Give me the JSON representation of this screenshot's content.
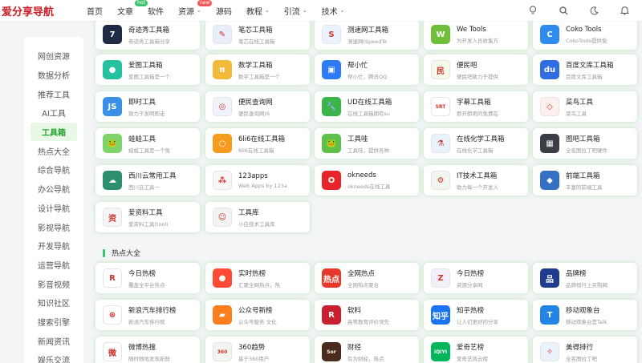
{
  "header": {
    "logo": "爱分享导航",
    "nav": [
      {
        "label": "首页",
        "chev": false
      },
      {
        "label": "文章",
        "chev": false,
        "badge": "hot",
        "badge_color": "green"
      },
      {
        "label": "软件",
        "chev": false
      },
      {
        "label": "资源",
        "chev": true,
        "badge": "new",
        "badge_color": "red"
      },
      {
        "label": "源码",
        "chev": false
      },
      {
        "label": "教程",
        "chev": true
      },
      {
        "label": "引流",
        "chev": true
      },
      {
        "label": "技术",
        "chev": true
      }
    ],
    "icons": [
      "bulb-icon",
      "search-icon",
      "moon-icon",
      "bell-icon"
    ]
  },
  "sidebar": {
    "items": [
      {
        "label": "网创资源",
        "active": false
      },
      {
        "label": "数据分析",
        "active": false
      },
      {
        "label": "推荐工具",
        "active": false
      },
      {
        "label": "AI工具",
        "active": false
      },
      {
        "label": "工具箱",
        "active": true
      },
      {
        "label": "热点大全",
        "active": false
      },
      {
        "label": "综合导航",
        "active": false
      },
      {
        "label": "办公导航",
        "active": false
      },
      {
        "label": "设计导航",
        "active": false
      },
      {
        "label": "影视导航",
        "active": false
      },
      {
        "label": "开发导航",
        "active": false
      },
      {
        "label": "运营导航",
        "active": false
      },
      {
        "label": "影音视频",
        "active": false
      },
      {
        "label": "知识社区",
        "active": false
      },
      {
        "label": "搜索引擎",
        "active": false
      },
      {
        "label": "新闻资讯",
        "active": false
      },
      {
        "label": "娱乐交流",
        "active": false
      }
    ]
  },
  "tools": [
    [
      {
        "title": "奇迹秀工具箱",
        "desc": "奇迹秀工具箱分享",
        "icon": "magic-icon",
        "color": "#1f2a44",
        "glyph": "7"
      },
      {
        "title": "笔芯工具箱",
        "desc": "笔芯在线工具箱",
        "icon": "pen-icon",
        "color": "#e9eefb",
        "glyph": "✎"
      },
      {
        "title": "测速网工具箱",
        "desc": "测速网(SpeedTe",
        "icon": "speed-icon",
        "color": "#eaf3ff",
        "glyph": "S"
      },
      {
        "title": "We Tools",
        "desc": "为开发人员收集方",
        "icon": "we-tools-icon",
        "color": "#6fbf3b",
        "glyph": "W"
      },
      {
        "title": "Coko Tools",
        "desc": "CokoTools提供免",
        "icon": "coko-icon",
        "color": "#2e8bf0",
        "glyph": "C"
      }
    ],
    [
      {
        "title": "爱图工具箱",
        "desc": "爱图工具箱是一个",
        "icon": "aitu-icon",
        "color": "#25c2a0",
        "glyph": "●"
      },
      {
        "title": "数学工具箱",
        "desc": "数学工具箱是一个",
        "icon": "math-icon",
        "color": "#f3b938",
        "glyph": "π"
      },
      {
        "title": "帮小忙",
        "desc": "帮小忙，腾讯QQ",
        "icon": "bangxiaomang-icon",
        "color": "#2e7bf6",
        "glyph": "▣"
      },
      {
        "title": "便民吧",
        "desc": "便民吧致力于提供",
        "icon": "bianmin-icon",
        "color": "#f4f9e8",
        "glyph": "民"
      },
      {
        "title": "百度文库工具箱",
        "desc": "百度文库工具箱",
        "icon": "baidu-icon",
        "color": "#2f6de1",
        "glyph": "du"
      }
    ],
    [
      {
        "title": "即时工具",
        "desc": "致力于发明即走",
        "icon": "js-icon",
        "color": "#3a8fe8",
        "glyph": "JS"
      },
      {
        "title": "便民查询网",
        "desc": "便民查询网(6",
        "icon": "globe-icon",
        "color": "#f0f4fa",
        "glyph": "◎"
      },
      {
        "title": "UD在线工具箱",
        "desc": "在线工具箱拥有su",
        "icon": "wrench-icon",
        "color": "#3bb54a",
        "glyph": "🔧"
      },
      {
        "title": "字幕工具箱",
        "desc": "即开即用的免费在",
        "icon": "srt-icon",
        "color": "#ffffff",
        "glyph": "SRT"
      },
      {
        "title": "菜鸟工具",
        "desc": "菜鸟工具",
        "icon": "cube-icon",
        "color": "#fdf0ee",
        "glyph": "◇"
      }
    ],
    [
      {
        "title": "蛙蛙工具",
        "desc": "蛙蛙工具是一个免",
        "icon": "frog-icon",
        "color": "#7ed36b",
        "glyph": "🐸"
      },
      {
        "title": "6li6在线工具箱",
        "desc": "6li6在线工具箱",
        "icon": "ring-icon",
        "color": "#f79b1e",
        "glyph": "○"
      },
      {
        "title": "工具哇",
        "desc": "工具哇，提供各种",
        "icon": "toolwa-icon",
        "color": "#5fc04a",
        "glyph": "🐸"
      },
      {
        "title": "在线化学工具箱",
        "desc": "在线化学工具箱",
        "icon": "flask-icon",
        "color": "#eaf2fd",
        "glyph": "⚗"
      },
      {
        "title": "图吧工具箱",
        "desc": "全名图拉丁吧硬件",
        "icon": "tuba-icon",
        "color": "#3a3d44",
        "glyph": "▦"
      }
    ],
    [
      {
        "title": "西川云常用工具",
        "desc": "西川云工具一",
        "icon": "xichuan-icon",
        "color": "#2d8f6e",
        "glyph": "☁"
      },
      {
        "title": "123apps",
        "desc": "Web Apps by 123a",
        "icon": "apps-icon",
        "color": "#f7f7f7",
        "glyph": "⁂"
      },
      {
        "title": "okneeds",
        "desc": "okneeds在线工具",
        "icon": "okneeds-icon",
        "color": "#e8242b",
        "glyph": "O"
      },
      {
        "title": "IT技术工具箱",
        "desc": "助力每一个开发人",
        "icon": "gear-icon",
        "color": "#f1f7ee",
        "glyph": "⚙"
      },
      {
        "title": "前端工具箱",
        "desc": "丰富的前端工具",
        "icon": "frontend-icon",
        "color": "#3670c4",
        "glyph": "◆"
      }
    ],
    [
      {
        "title": "爱资料工具",
        "desc": "爱资料工具(tooli",
        "icon": "aiziliao-icon",
        "color": "#f5f5f5",
        "glyph": "资"
      },
      {
        "title": "工具库",
        "desc": "小白技术工具库",
        "icon": "person-icon",
        "color": "#f3f3f3",
        "glyph": "☺"
      }
    ]
  ],
  "hot_section": {
    "title": "热点大全",
    "rows": [
      [
        {
          "title": "今日热榜",
          "desc": "覆盖全平台热点",
          "icon": "r-icon",
          "color": "#ffffff",
          "glyph": "R"
        },
        {
          "title": "实时热榜",
          "desc": "汇聚全网热点，热",
          "icon": "fire-icon",
          "color": "#ff4b36",
          "glyph": "●"
        },
        {
          "title": "全网热点",
          "desc": "全网热点聚合",
          "icon": "redian-icon",
          "color": "#e6392b",
          "glyph": "热点"
        },
        {
          "title": "今日热榜",
          "desc": "资源分享网",
          "icon": "z-icon",
          "color": "#f4f0fa",
          "glyph": "Z"
        },
        {
          "title": "品牌榜",
          "desc": "品牌榜行上买购网",
          "icon": "brand-icon",
          "color": "#1f3c8f",
          "glyph": "品"
        }
      ],
      [
        {
          "title": "新浪汽车排行榜",
          "desc": "新浪汽车排行榜",
          "icon": "sina-car-icon",
          "color": "#ffffff",
          "glyph": "⊕"
        },
        {
          "title": "公众号新榜",
          "desc": "公众号服务  文化",
          "icon": "newrank-icon",
          "color": "#fb7e1e",
          "glyph": "▰"
        },
        {
          "title": "软科",
          "desc": "高等教育评价领先",
          "icon": "ruanke-icon",
          "color": "#c8202f",
          "glyph": "R"
        },
        {
          "title": "知乎热榜",
          "desc": "让人们更好的分享",
          "icon": "zhihu-icon",
          "color": "#1a74f0",
          "glyph": "知乎"
        },
        {
          "title": "移动观象台",
          "desc": "移动观象台是Talk",
          "icon": "talkingdata-icon",
          "color": "#2484e6",
          "glyph": "T"
        }
      ],
      [
        {
          "title": "微博热搜",
          "desc": "随时随地发现新鲜",
          "icon": "weibo-icon",
          "color": "#ffffff",
          "glyph": "微"
        },
        {
          "title": "360趋势",
          "desc": "基于360用户",
          "icon": "360-icon",
          "color": "#f1f6f1",
          "glyph": "360"
        },
        {
          "title": "财经",
          "desc": "有为财经，热点",
          "icon": "caijing-icon",
          "color": "#4c2a1d",
          "glyph": "Sor"
        },
        {
          "title": "爱奇艺榜",
          "desc": "爱奇艺风云榜",
          "icon": "iqiyi-icon",
          "color": "#00b55a",
          "glyph": "iQIYI"
        },
        {
          "title": "美得排行",
          "desc": "全名图拉丁吧",
          "icon": "meide-icon",
          "color": "#eaf3fb",
          "glyph": "✧"
        }
      ]
    ]
  }
}
